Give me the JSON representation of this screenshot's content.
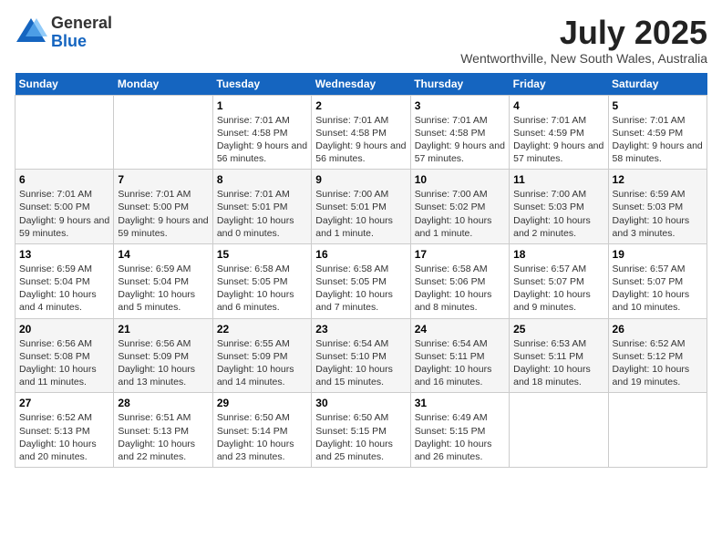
{
  "header": {
    "logo_general": "General",
    "logo_blue": "Blue",
    "month": "July 2025",
    "location": "Wentworthville, New South Wales, Australia"
  },
  "days_of_week": [
    "Sunday",
    "Monday",
    "Tuesday",
    "Wednesday",
    "Thursday",
    "Friday",
    "Saturday"
  ],
  "weeks": [
    [
      {
        "day": "",
        "info": ""
      },
      {
        "day": "",
        "info": ""
      },
      {
        "day": "1",
        "info": "Sunrise: 7:01 AM\nSunset: 4:58 PM\nDaylight: 9 hours\nand 56 minutes."
      },
      {
        "day": "2",
        "info": "Sunrise: 7:01 AM\nSunset: 4:58 PM\nDaylight: 9 hours\nand 56 minutes."
      },
      {
        "day": "3",
        "info": "Sunrise: 7:01 AM\nSunset: 4:58 PM\nDaylight: 9 hours\nand 57 minutes."
      },
      {
        "day": "4",
        "info": "Sunrise: 7:01 AM\nSunset: 4:59 PM\nDaylight: 9 hours\nand 57 minutes."
      },
      {
        "day": "5",
        "info": "Sunrise: 7:01 AM\nSunset: 4:59 PM\nDaylight: 9 hours\nand 58 minutes."
      }
    ],
    [
      {
        "day": "6",
        "info": "Sunrise: 7:01 AM\nSunset: 5:00 PM\nDaylight: 9 hours\nand 59 minutes."
      },
      {
        "day": "7",
        "info": "Sunrise: 7:01 AM\nSunset: 5:00 PM\nDaylight: 9 hours\nand 59 minutes."
      },
      {
        "day": "8",
        "info": "Sunrise: 7:01 AM\nSunset: 5:01 PM\nDaylight: 10 hours\nand 0 minutes."
      },
      {
        "day": "9",
        "info": "Sunrise: 7:00 AM\nSunset: 5:01 PM\nDaylight: 10 hours\nand 1 minute."
      },
      {
        "day": "10",
        "info": "Sunrise: 7:00 AM\nSunset: 5:02 PM\nDaylight: 10 hours\nand 1 minute."
      },
      {
        "day": "11",
        "info": "Sunrise: 7:00 AM\nSunset: 5:03 PM\nDaylight: 10 hours\nand 2 minutes."
      },
      {
        "day": "12",
        "info": "Sunrise: 6:59 AM\nSunset: 5:03 PM\nDaylight: 10 hours\nand 3 minutes."
      }
    ],
    [
      {
        "day": "13",
        "info": "Sunrise: 6:59 AM\nSunset: 5:04 PM\nDaylight: 10 hours\nand 4 minutes."
      },
      {
        "day": "14",
        "info": "Sunrise: 6:59 AM\nSunset: 5:04 PM\nDaylight: 10 hours\nand 5 minutes."
      },
      {
        "day": "15",
        "info": "Sunrise: 6:58 AM\nSunset: 5:05 PM\nDaylight: 10 hours\nand 6 minutes."
      },
      {
        "day": "16",
        "info": "Sunrise: 6:58 AM\nSunset: 5:05 PM\nDaylight: 10 hours\nand 7 minutes."
      },
      {
        "day": "17",
        "info": "Sunrise: 6:58 AM\nSunset: 5:06 PM\nDaylight: 10 hours\nand 8 minutes."
      },
      {
        "day": "18",
        "info": "Sunrise: 6:57 AM\nSunset: 5:07 PM\nDaylight: 10 hours\nand 9 minutes."
      },
      {
        "day": "19",
        "info": "Sunrise: 6:57 AM\nSunset: 5:07 PM\nDaylight: 10 hours\nand 10 minutes."
      }
    ],
    [
      {
        "day": "20",
        "info": "Sunrise: 6:56 AM\nSunset: 5:08 PM\nDaylight: 10 hours\nand 11 minutes."
      },
      {
        "day": "21",
        "info": "Sunrise: 6:56 AM\nSunset: 5:09 PM\nDaylight: 10 hours\nand 13 minutes."
      },
      {
        "day": "22",
        "info": "Sunrise: 6:55 AM\nSunset: 5:09 PM\nDaylight: 10 hours\nand 14 minutes."
      },
      {
        "day": "23",
        "info": "Sunrise: 6:54 AM\nSunset: 5:10 PM\nDaylight: 10 hours\nand 15 minutes."
      },
      {
        "day": "24",
        "info": "Sunrise: 6:54 AM\nSunset: 5:11 PM\nDaylight: 10 hours\nand 16 minutes."
      },
      {
        "day": "25",
        "info": "Sunrise: 6:53 AM\nSunset: 5:11 PM\nDaylight: 10 hours\nand 18 minutes."
      },
      {
        "day": "26",
        "info": "Sunrise: 6:52 AM\nSunset: 5:12 PM\nDaylight: 10 hours\nand 19 minutes."
      }
    ],
    [
      {
        "day": "27",
        "info": "Sunrise: 6:52 AM\nSunset: 5:13 PM\nDaylight: 10 hours\nand 20 minutes."
      },
      {
        "day": "28",
        "info": "Sunrise: 6:51 AM\nSunset: 5:13 PM\nDaylight: 10 hours\nand 22 minutes."
      },
      {
        "day": "29",
        "info": "Sunrise: 6:50 AM\nSunset: 5:14 PM\nDaylight: 10 hours\nand 23 minutes."
      },
      {
        "day": "30",
        "info": "Sunrise: 6:50 AM\nSunset: 5:15 PM\nDaylight: 10 hours\nand 25 minutes."
      },
      {
        "day": "31",
        "info": "Sunrise: 6:49 AM\nSunset: 5:15 PM\nDaylight: 10 hours\nand 26 minutes."
      },
      {
        "day": "",
        "info": ""
      },
      {
        "day": "",
        "info": ""
      }
    ]
  ]
}
